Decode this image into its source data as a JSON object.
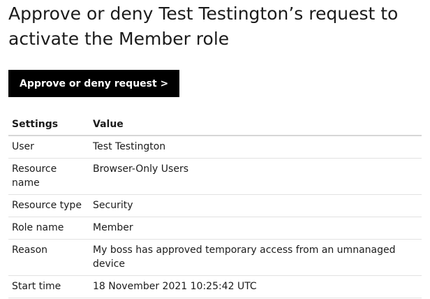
{
  "heading": "Approve or deny Test Testington’s request to activate the Member role",
  "button_label": "Approve or deny request >",
  "table": {
    "headers": [
      "Settings",
      "Value"
    ],
    "rows": [
      {
        "setting": "User",
        "value": "Test Testington"
      },
      {
        "setting": "Resource name",
        "value": "Browser-Only Users"
      },
      {
        "setting": "Resource type",
        "value": "Security"
      },
      {
        "setting": "Role name",
        "value": "Member"
      },
      {
        "setting": "Reason",
        "value": "My boss has approved temporary access from an umnanaged device"
      },
      {
        "setting": "Start time",
        "value": "18 November 2021 10:25:42 UTC"
      }
    ]
  },
  "colors": {
    "button_background": "#000000",
    "button_text": "#ffffff",
    "text": "#1b1b1b"
  }
}
